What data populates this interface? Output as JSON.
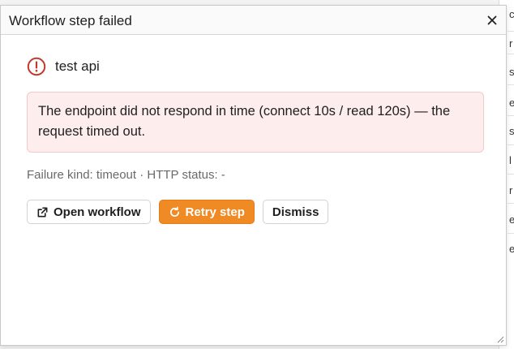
{
  "dialog": {
    "title": "Workflow step failed",
    "close_icon": "close-icon"
  },
  "step": {
    "name": "test api",
    "icon": "error-circle-icon",
    "icon_color": "#c0392b"
  },
  "error": {
    "message": "The endpoint did not respond in time (connect 10s / read 120s) — the request timed out.",
    "meta": "Failure kind: timeout · HTTP status: -"
  },
  "actions": {
    "open_label": "Open workflow",
    "open_icon": "external-link-icon",
    "retry_label": "Retry step",
    "retry_icon": "refresh-icon",
    "dismiss_label": "Dismiss"
  },
  "colors": {
    "accent": "#f08a24",
    "error_bg": "#fdeded",
    "error_border": "#f3caca"
  },
  "background": {
    "partial_letters": [
      "c",
      "r",
      "s",
      "e",
      "s",
      "l",
      "r",
      "e",
      "e"
    ]
  }
}
